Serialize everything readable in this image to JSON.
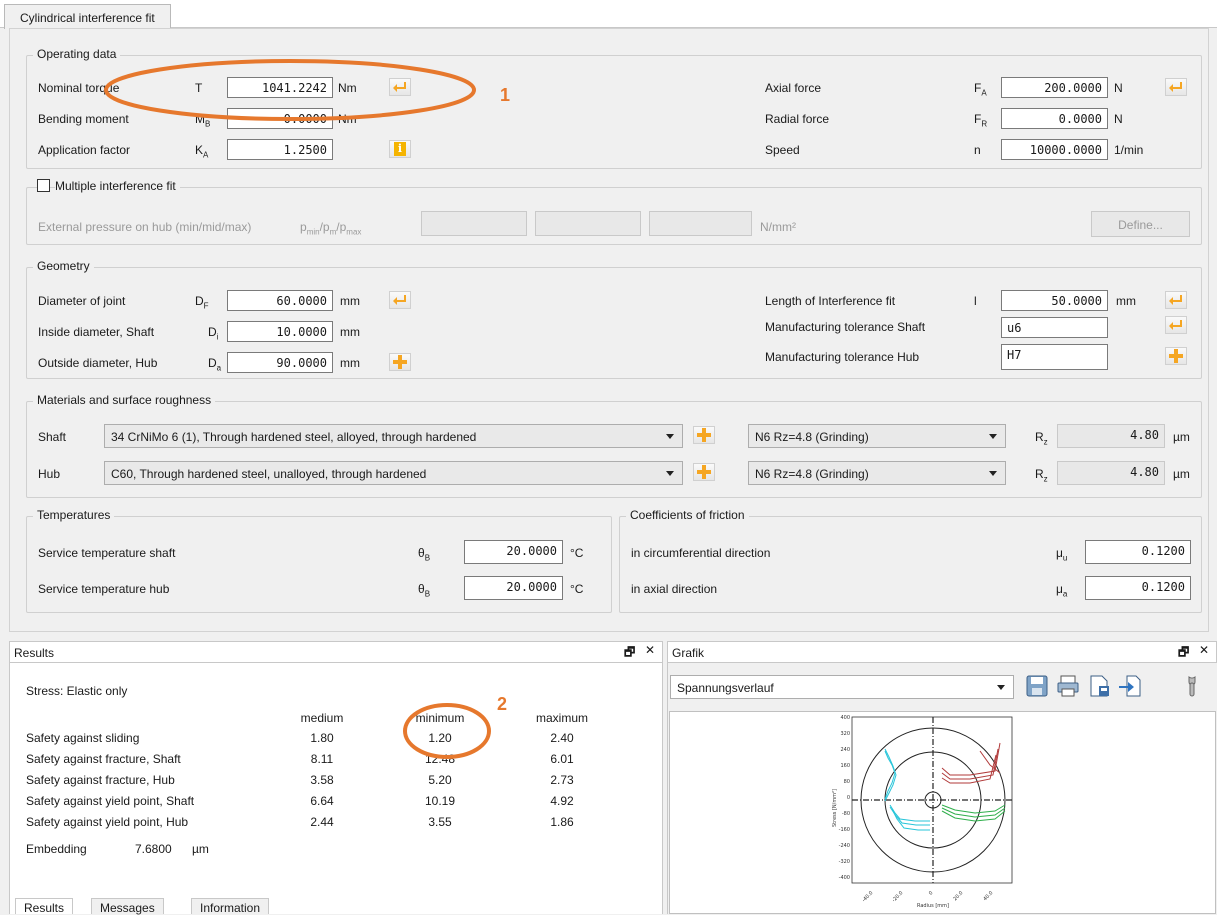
{
  "tab": {
    "title": "Cylindrical interference fit"
  },
  "operating": {
    "title": "Operating data",
    "nominal_torque": {
      "label": "Nominal torque",
      "sym": "T",
      "value": "1041.2242",
      "unit": "Nm"
    },
    "bending_moment": {
      "label": "Bending moment",
      "sym": "MB",
      "value": "0.0000",
      "unit": "Nm"
    },
    "application_factor": {
      "label": "Application factor",
      "sym": "KA",
      "value": "1.2500"
    },
    "axial_force": {
      "label": "Axial force",
      "sym": "FA",
      "value": "200.0000",
      "unit": "N"
    },
    "radial_force": {
      "label": "Radial force",
      "sym": "FR",
      "value": "0.0000",
      "unit": "N"
    },
    "speed": {
      "label": "Speed",
      "sym": "n",
      "value": "10000.0000",
      "unit": "1/min"
    }
  },
  "multiple": {
    "checkbox_label": "Multiple interference fit",
    "pressure_label": "External pressure on hub (min/mid/max)",
    "pressure_sym": "pmin/pm/pmax",
    "unit": "N/mm²",
    "define": "Define..."
  },
  "geometry": {
    "title": "Geometry",
    "diameter_joint": {
      "label": "Diameter of joint",
      "sym": "DF",
      "value": "60.0000",
      "unit": "mm"
    },
    "inside_diameter": {
      "label": "Inside diameter, Shaft",
      "sym": "Di",
      "value": "10.0000",
      "unit": "mm"
    },
    "outside_diameter": {
      "label": "Outside diameter, Hub",
      "sym": "Da",
      "value": "90.0000",
      "unit": "mm"
    },
    "length": {
      "label": "Length of Interference fit",
      "sym": "l",
      "value": "50.0000",
      "unit": "mm"
    },
    "tol_shaft": {
      "label": "Manufacturing tolerance Shaft",
      "value": "u6"
    },
    "tol_hub": {
      "label": "Manufacturing tolerance Hub",
      "value": "H7"
    }
  },
  "materials": {
    "title": "Materials and surface roughness",
    "shaft": {
      "label": "Shaft",
      "material": "34 CrNiMo 6 (1), Through hardened steel, alloyed, through hardened",
      "roughness": "N6  Rz=4.8 (Grinding)",
      "sym": "Rz",
      "value": "4.80",
      "unit": "µm"
    },
    "hub": {
      "label": "Hub",
      "material": "C60, Through hardened steel, unalloyed, through hardened",
      "roughness": "N6  Rz=4.8 (Grinding)",
      "sym": "Rz",
      "value": "4.80",
      "unit": "µm"
    }
  },
  "temperatures": {
    "title": "Temperatures",
    "shaft": {
      "label": "Service temperature shaft",
      "sym": "θB",
      "value": "20.0000",
      "unit": "°C"
    },
    "hub": {
      "label": "Service temperature hub",
      "sym": "θB",
      "value": "20.0000",
      "unit": "°C"
    }
  },
  "friction": {
    "title": "Coefficients of friction",
    "circ": {
      "label": "in circumferential direction",
      "sym": "μu",
      "value": "0.1200"
    },
    "axial": {
      "label": "in axial direction",
      "sym": "μa",
      "value": "0.1200"
    }
  },
  "results": {
    "pane_title": "Results",
    "stress": "Stress: Elastic only",
    "headers": [
      "medium",
      "minimum",
      "maximum"
    ],
    "rows": [
      {
        "label": "Safety against sliding",
        "vals": [
          "1.80",
          "1.20",
          "2.40"
        ]
      },
      {
        "label": "Safety against fracture, Shaft",
        "vals": [
          "8.11",
          "12.48",
          "6.01"
        ]
      },
      {
        "label": "Safety against fracture, Hub",
        "vals": [
          "3.58",
          "5.20",
          "2.73"
        ]
      },
      {
        "label": "Safety against yield point, Shaft",
        "vals": [
          "6.64",
          "10.19",
          "4.92"
        ]
      },
      {
        "label": "Safety against yield point, Hub",
        "vals": [
          "2.44",
          "3.55",
          "1.86"
        ]
      }
    ],
    "embedding_label": "Embedding",
    "embedding_value": "7.6800",
    "embedding_unit": "µm",
    "tabs": [
      "Results",
      "Messages",
      "Information"
    ]
  },
  "grafik": {
    "pane_title": "Grafik",
    "selector": "Spannungsverlauf",
    "y_ticks": [
      "400",
      "320",
      "240",
      "160",
      "80",
      "0",
      "-80",
      "-160",
      "-240",
      "-320",
      "-400"
    ],
    "x_ticks": [
      "-40.0",
      "-20.0",
      "0",
      "20.0",
      "40.0"
    ],
    "ylabel": "Stress [N/mm²]",
    "xlabel": "Radius [mm]"
  },
  "annotations": [
    "1",
    "2"
  ],
  "colors": {
    "annotation": "#e6782d",
    "icon_accent": "#f5a623",
    "plot_cyan": "#27c5d9",
    "plot_red": "#b13a3a",
    "plot_green": "#2fae4b"
  }
}
